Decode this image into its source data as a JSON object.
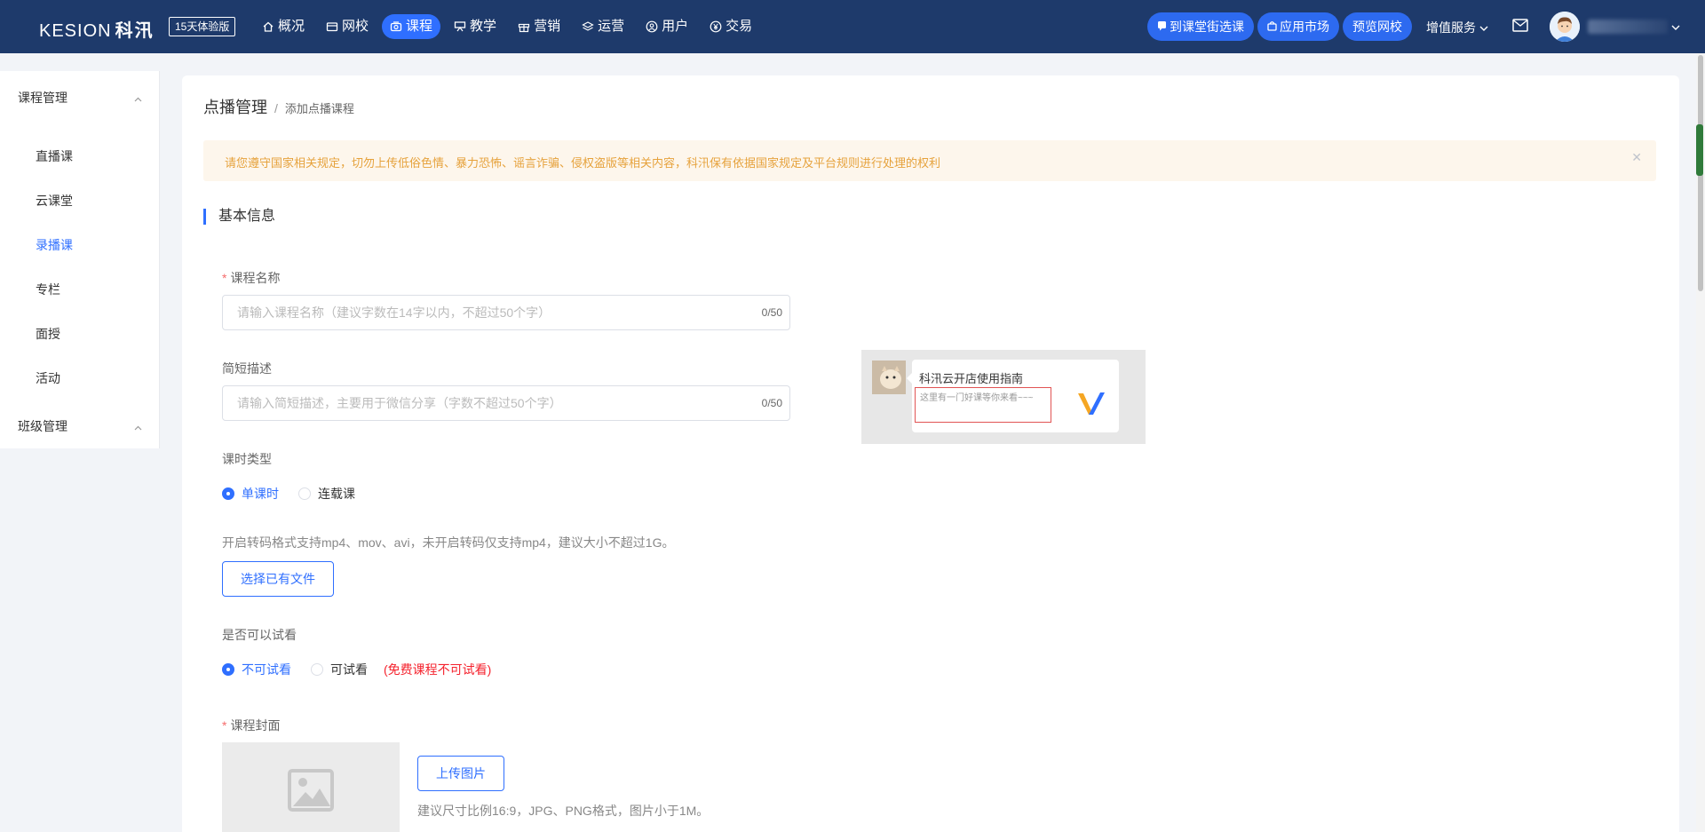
{
  "topbar": {
    "logo_text": "KESION",
    "logo_cn": "科汛",
    "trial_badge": "15天体验版",
    "nav": [
      {
        "label": "概况",
        "icon": "home-icon"
      },
      {
        "label": "网校",
        "icon": "school-icon"
      },
      {
        "label": "课程",
        "icon": "course-icon"
      },
      {
        "label": "教学",
        "icon": "teaching-icon"
      },
      {
        "label": "营销",
        "icon": "gift-icon"
      },
      {
        "label": "运营",
        "icon": "layers-icon"
      },
      {
        "label": "用户",
        "icon": "user-icon"
      },
      {
        "label": "交易",
        "icon": "yen-icon"
      }
    ],
    "active_nav": "课程",
    "actions": [
      "到课堂街选课",
      "应用市场",
      "预览网校"
    ],
    "value_added": "增值服务"
  },
  "sidebar": {
    "group1": "课程管理",
    "items": [
      "直播课",
      "云课堂",
      "录播课",
      "专栏",
      "面授",
      "活动"
    ],
    "active_item": "录播课",
    "group2": "班级管理"
  },
  "breadcrumb": {
    "parent": "点播管理",
    "separator": "/",
    "current": "添加点播课程"
  },
  "notice": "请您遵守国家相关规定，切勿上传低俗色情、暴力恐怖、谣言诈骗、侵权盗版等相关内容，科汛保有依据国家规定及平台规则进行处理的权利",
  "section_title": "基本信息",
  "form": {
    "name_label": "课程名称",
    "name_placeholder": "请输入课程名称（建议字数在14字以内，不超过50个字）",
    "name_count": "0/50",
    "desc_label": "简短描述",
    "desc_placeholder": "请输入简短描述，主要用于微信分享（字数不超过50个字）",
    "desc_count": "0/50",
    "type_label": "课时类型",
    "type_options": [
      "单课时",
      "连载课"
    ],
    "type_selected": "单课时",
    "upload_hint": "开启转码格式支持mp4、mov、avi，未开启转码仅支持mp4，建议大小不超过1G。",
    "choose_file_btn": "选择已有文件",
    "trial_label": "是否可以试看",
    "trial_options": [
      "不可试看",
      "可试看"
    ],
    "trial_selected": "不可试看",
    "trial_note": "(免费课程不可试看)",
    "cover_label": "课程封面",
    "upload_btn": "上传图片",
    "cover_hint": "建议尺寸比例16:9，JPG、PNG格式，图片小于1M。"
  },
  "preview": {
    "title": "科汛云开店使用指南",
    "desc": "这里有一门好课等你来看~~~"
  },
  "colors": {
    "nav_bg": "#1e3a6b",
    "accent": "#2f6fff",
    "warning_text": "#e6a23c",
    "warning_bg": "#fdf6ec",
    "danger": "#f5222d"
  }
}
